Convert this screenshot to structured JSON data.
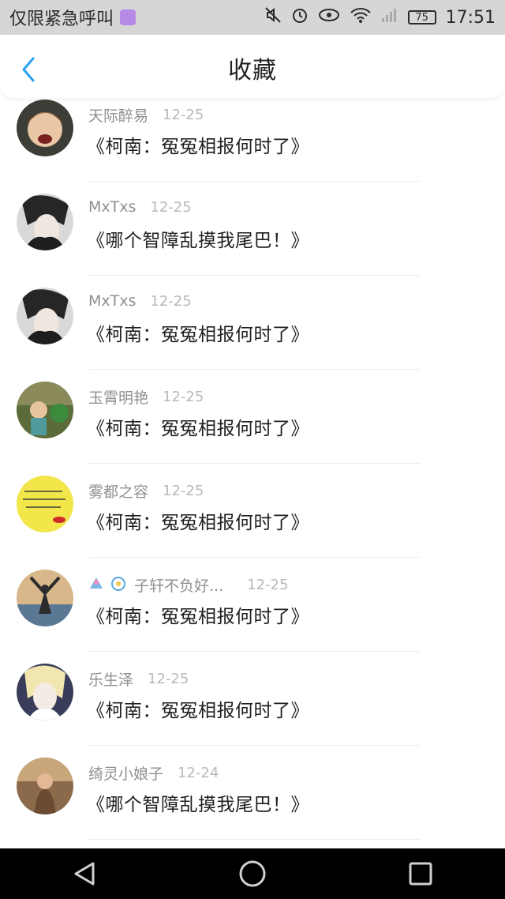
{
  "status_bar": {
    "left_text": "仅限紧急呼叫",
    "battery": "75",
    "time": "17:51"
  },
  "header": {
    "title": "收藏"
  },
  "favorites": [
    {
      "name": "天际醉易",
      "date": "12-25",
      "title": "《柯南：冤冤相报何时了》"
    },
    {
      "name": "MxTxs",
      "date": "12-25",
      "title": "《哪个智障乱摸我尾巴！》"
    },
    {
      "name": "MxTxs",
      "date": "12-25",
      "title": "《柯南：冤冤相报何时了》"
    },
    {
      "name": "玉霄明艳",
      "date": "12-25",
      "title": "《柯南：冤冤相报何时了》"
    },
    {
      "name": "雾都之容",
      "date": "12-25",
      "title": "《柯南：冤冤相报何时了》"
    },
    {
      "name": "子轩不负好...",
      "date": "12-25",
      "title": "《柯南：冤冤相报何时了》"
    },
    {
      "name": "乐生泽",
      "date": "12-25",
      "title": "《柯南：冤冤相报何时了》"
    },
    {
      "name": "绮灵小娘子",
      "date": "12-24",
      "title": "《哪个智障乱摸我尾巴！》"
    }
  ],
  "colors": {
    "accent": "#2aa3f3",
    "status_bar_bg": "#d6d6d6",
    "bottom_bar_bg": "#000000"
  }
}
